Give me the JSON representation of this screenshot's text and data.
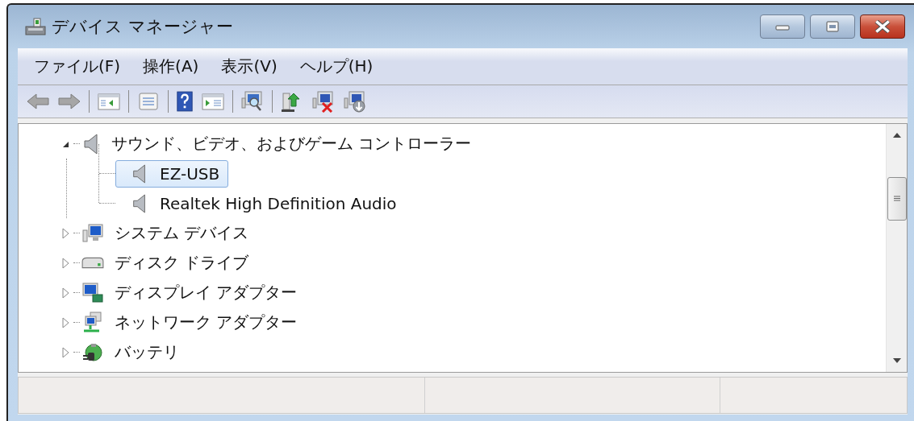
{
  "window": {
    "title": "デバイス マネージャー"
  },
  "menu": [
    "ファイル(F)",
    "操作(A)",
    "表示(V)",
    "ヘルプ(H)"
  ],
  "tree": [
    {
      "label": "サウンド、ビデオ、およびゲーム コントローラー",
      "expanded": true,
      "selected": false,
      "children": [
        {
          "label": "EZ-USB",
          "selected": true
        },
        {
          "label": "Realtek High Definition Audio",
          "selected": false
        }
      ]
    },
    {
      "label": "システム デバイス",
      "expanded": false,
      "selected": false
    },
    {
      "label": "ディスク ドライブ",
      "expanded": false,
      "selected": false
    },
    {
      "label": "ディスプレイ アダプター",
      "expanded": false,
      "selected": false
    },
    {
      "label": "ネットワーク アダプター",
      "expanded": false,
      "selected": false
    },
    {
      "label": "バッテリ",
      "expanded": false,
      "selected": false
    }
  ]
}
